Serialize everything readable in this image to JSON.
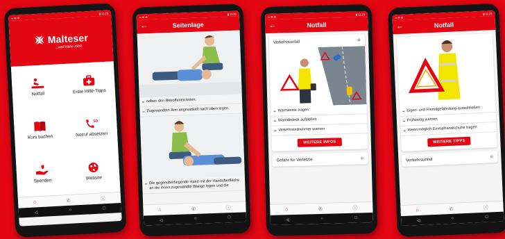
{
  "colors": {
    "brand_red": "#e30613",
    "screen_bg": "#f4f4f4"
  },
  "home": {
    "brand": "Malteser",
    "tagline": "...weil Nähe zählt.",
    "tiles": [
      {
        "label": "Notfall",
        "icon": "cpr-person-icon"
      },
      {
        "label": "Erste Hilfe-Tipps",
        "icon": "first-aid-kit-icon"
      },
      {
        "label": "Kurs buchen",
        "icon": "book-icon"
      },
      {
        "label": "Notruf absetzen",
        "icon": "phone-sos-icon"
      },
      {
        "label": "Spenden",
        "icon": "donate-hand-icon"
      },
      {
        "label": "Website",
        "icon": "globe-icon"
      }
    ]
  },
  "seitenlage": {
    "title": "Seitenlage",
    "steps": [
      "neben den Betroffenen knien.",
      "Zugewandten Arm angewinkelt nach oben legen.",
      "Die gegenüberliegende Hand mit der Handoberfläche an die ihnen zugewandte Wange legen und die"
    ]
  },
  "notfall1": {
    "title": "Notfall",
    "card_title": "Verkehrsunfall",
    "bullets": [
      "Warnweste tragen",
      "Warndreieck aufstellen",
      "Verkehrsteilnehmer warnen"
    ],
    "button": "WEITERE INFOS",
    "card2_title": "Gefahr für Verletzte"
  },
  "notfall2": {
    "title": "Notfall",
    "bullets": [
      "Eigen- und Fremdgefährdung ausschließen",
      "Frühzeitig warnen",
      "Wenn möglich Einmalhandschuhe tragen"
    ],
    "button": "WEITERE TIPPS",
    "card2_title": "Verkehrsunfall"
  },
  "tabs": {
    "home": "home-icon",
    "phone": "phone-icon",
    "info": "info-icon"
  }
}
